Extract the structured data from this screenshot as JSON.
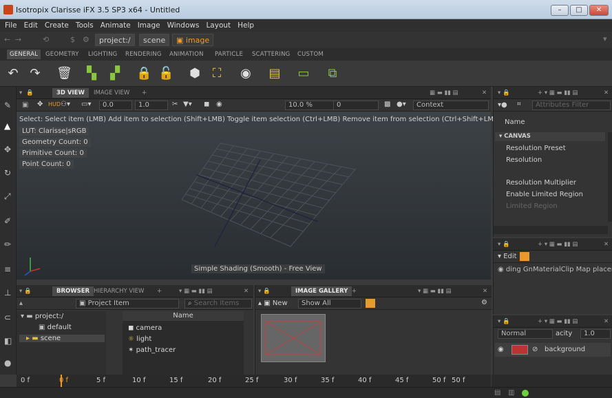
{
  "window": {
    "title": "Isotropix Clarisse iFX 3.5 SP3 x64  - Untitled"
  },
  "menu": [
    "File",
    "Edit",
    "Create",
    "Tools",
    "Animate",
    "Image",
    "Windows",
    "Layout",
    "Help"
  ],
  "address": {
    "root": "project:/",
    "scene": "scene",
    "image": "image"
  },
  "tabs": [
    "GENERAL",
    "GEOMETRY",
    "LIGHTING",
    "RENDERING",
    "ANIMATION",
    "PARTICLE",
    "SCATTERING",
    "CUSTOM"
  ],
  "viewport": {
    "tabs": [
      "3D VIEW",
      "IMAGE VIEW"
    ],
    "field_a": "0.0",
    "field_b": "1.0",
    "zoom": "10.0 %",
    "frame": "0",
    "context": "Context",
    "hint": "Select: Select item (LMB)  Add item to selection (Shift+LMB)  Toggle item selection (Ctrl+LMB)  Remove item from selection (Ctrl+Shift+LMB)  - Mo",
    "lut": "LUT: Clarisse|sRGB",
    "geometry_count": "Geometry Count: 0",
    "primitive_count": "Primitive Count: 0",
    "point_count": "Point Count: 0",
    "shading": "Simple Shading (Smooth) - Free View"
  },
  "attributes": {
    "filter_placeholder": "Attributes Filter",
    "name_label": "Name",
    "section": "CANVAS",
    "rows": [
      "Resolution Preset",
      "Resolution",
      "Resolution Multiplier",
      "Enable Limited Region",
      "Limited Region"
    ]
  },
  "materials_panel": {
    "edit": "Edit",
    "columns": "ding GnMaterialClip Map placem"
  },
  "layers_panel": {
    "blend": "Normal",
    "opacity_label": "acity",
    "opacity": "1.0",
    "layer": "background"
  },
  "browser": {
    "tabs": [
      "BROWSER",
      "HIERARCHY VIEW"
    ],
    "project_item": "Project Item",
    "search_placeholder": "Search Items",
    "tree": [
      "project:/",
      "default",
      "scene"
    ],
    "name_header": "Name",
    "items": [
      "camera",
      "light",
      "path_tracer"
    ]
  },
  "gallery": {
    "tab": "IMAGE GALLERY",
    "new_label": "New",
    "filter": "Show All"
  },
  "timeline": [
    "0 f",
    "0 f",
    "5 f",
    "10 f",
    "15 f",
    "20 f",
    "25 f",
    "30 f",
    "35 f",
    "40 f",
    "45 f",
    "50 f",
    "50 f"
  ],
  "colors": {
    "accent_green": "#8cc63f",
    "accent_orange": "#e89a2c",
    "title_bar": "#c6d6e8"
  }
}
